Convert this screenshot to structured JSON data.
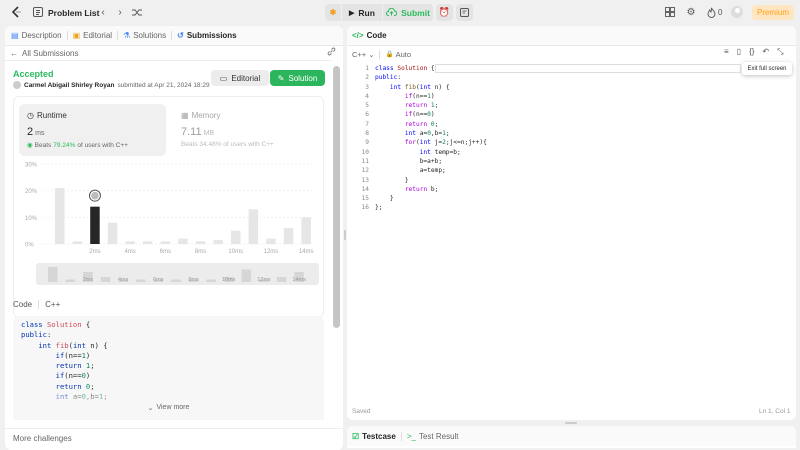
{
  "topbar": {
    "title": "Problem List",
    "run_label": "Run",
    "submit_label": "Submit",
    "streak_count": "0",
    "premium_label": "Premium"
  },
  "left": {
    "tabs": [
      "Description",
      "Editorial",
      "Solutions",
      "Submissions"
    ],
    "back_label": "All Submissions",
    "status": "Accepted",
    "author": "Carmel Abigail Shirley Royan",
    "submitted_at": "submitted at Apr 21, 2024 18:29",
    "editorial_btn": "Editorial",
    "solution_btn": "Solution",
    "runtime_title": "Runtime",
    "runtime_value": "2",
    "runtime_unit": "ms",
    "runtime_beats_prefix": "Beats",
    "runtime_beats_pct": "79.24%",
    "runtime_beats_suffix": "of users with C++",
    "memory_title": "Memory",
    "memory_value": "7.11",
    "memory_unit": "MB",
    "memory_beats": "Beats 34.48% of users with C++",
    "code_label": "Code",
    "lang_label": "C++",
    "view_more": "View more",
    "more_challenges": "More challenges"
  },
  "chart_data": {
    "type": "bar",
    "y_ticks": [
      "30%",
      "20%",
      "10%",
      "0%"
    ],
    "ylim": [
      0,
      30
    ],
    "x_tick_labels": [
      "2ms",
      "4ms",
      "6ms",
      "8ms",
      "10ms",
      "12ms",
      "14ms"
    ],
    "values": [
      21,
      1,
      14,
      8,
      1,
      1,
      1,
      2,
      1,
      1.5,
      5,
      13,
      2,
      6,
      10
    ],
    "highlight_index": 2,
    "overview_values": [
      6,
      1,
      4,
      2,
      1,
      1,
      1,
      1,
      1,
      1,
      2,
      5,
      1,
      2,
      4
    ]
  },
  "right": {
    "code_tab": "Code",
    "lang": "C++",
    "auto_label": "Auto",
    "tooltip": "Exit full screen",
    "saved": "Saved",
    "cursor_pos": "Ln 1, Col 1",
    "testcase_tab": "Testcase",
    "testresult_tab": "Test Result"
  },
  "colors": {
    "accent_green": "#2db55d",
    "status_green": "#2cbb5d",
    "premium": "#ffa116",
    "bar_grey": "#e6e6e6",
    "bar_selected": "#262626"
  }
}
